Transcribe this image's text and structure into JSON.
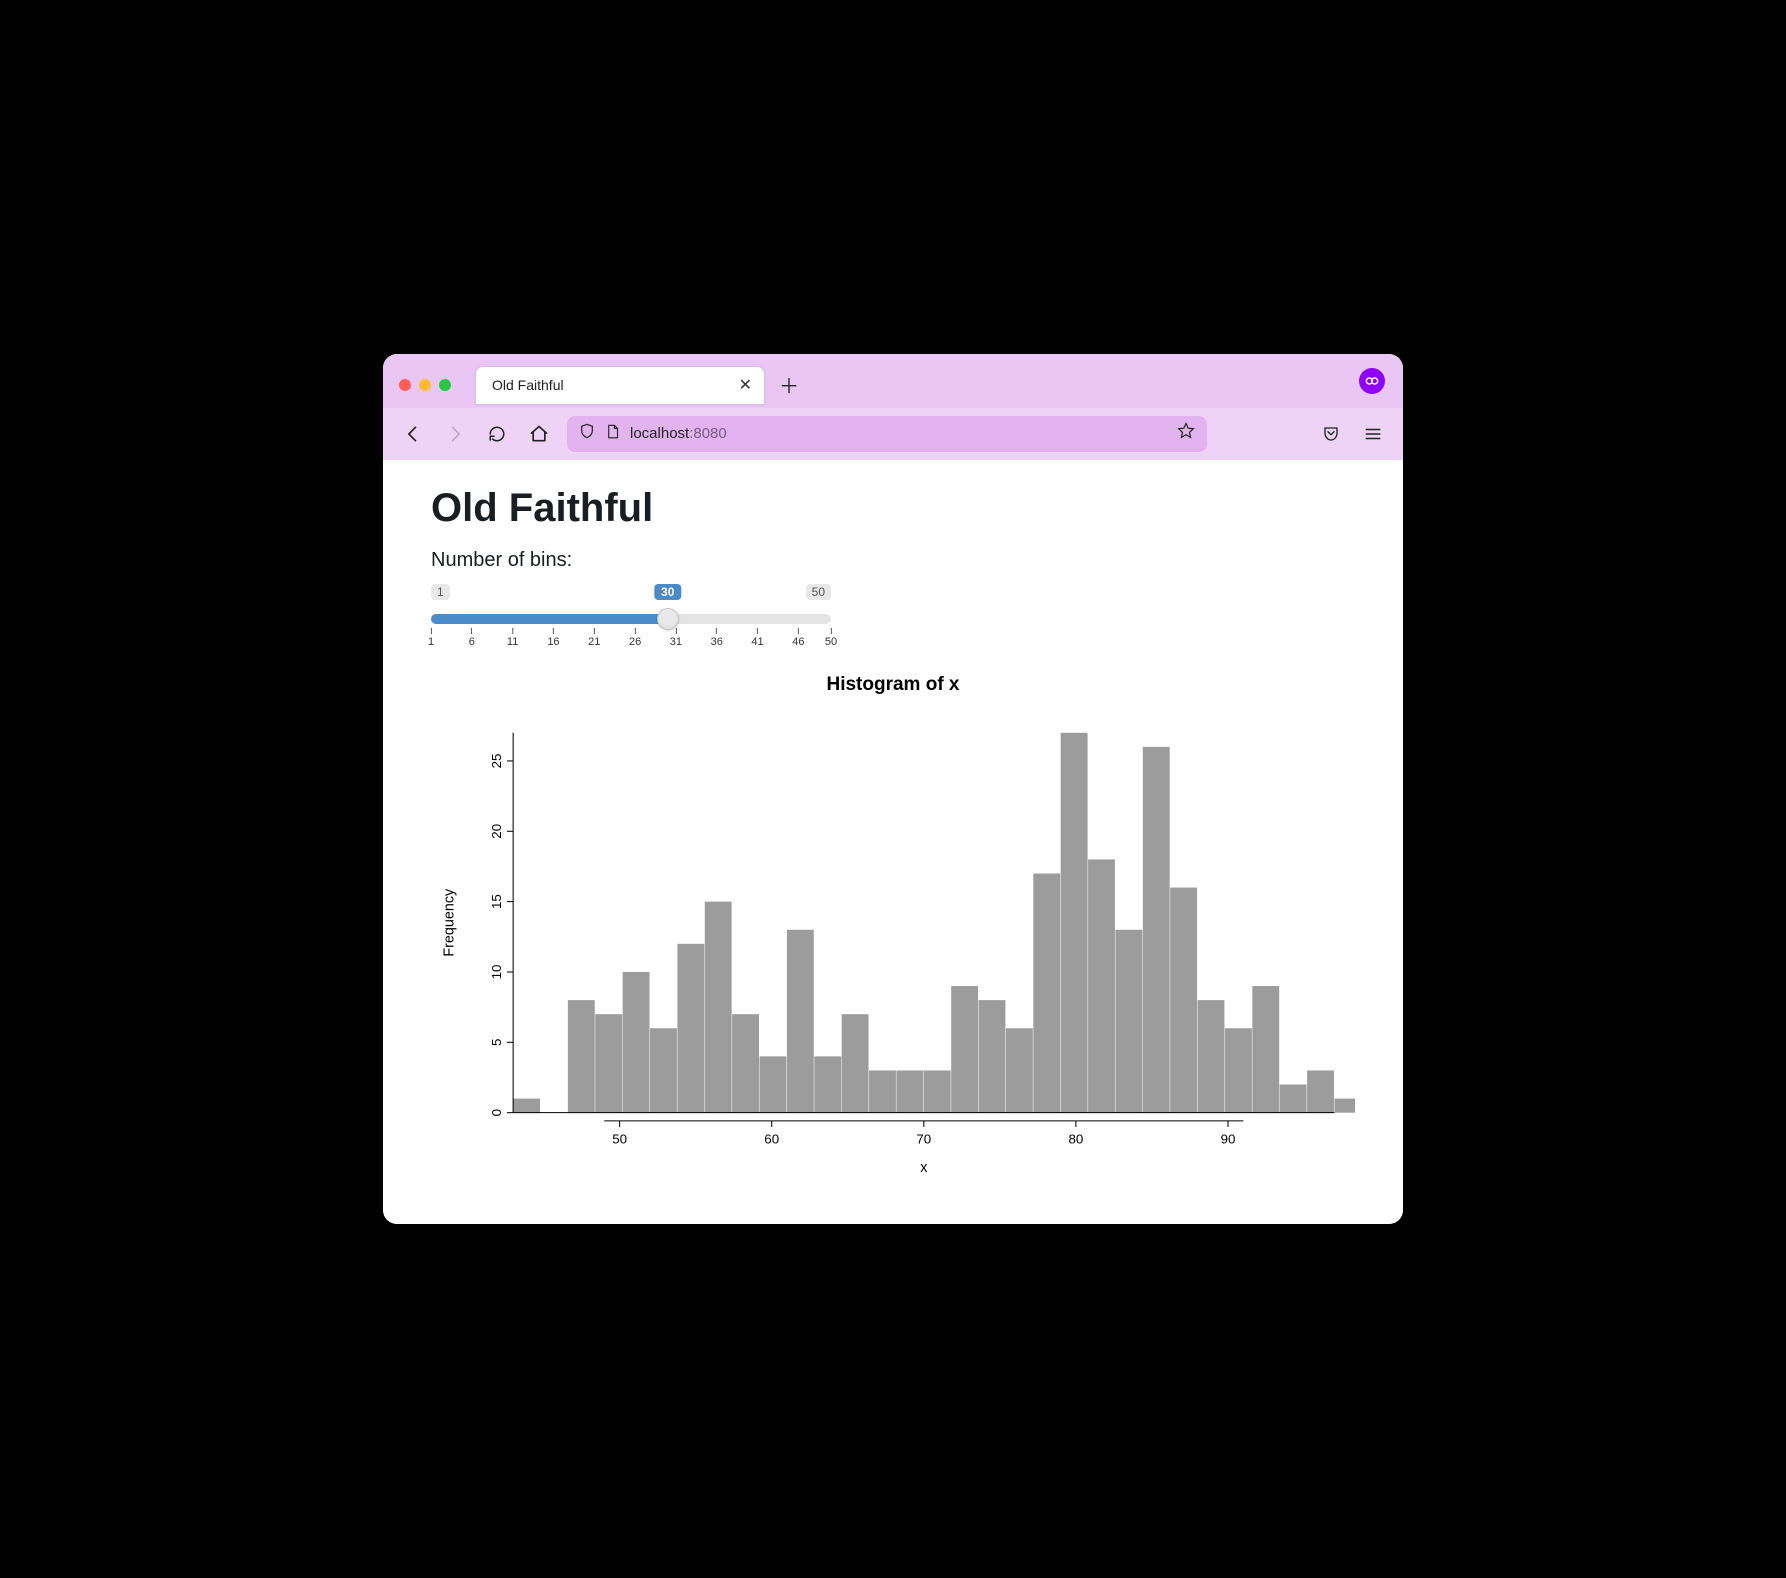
{
  "browser": {
    "tab_title": "Old Faithful",
    "url_host": "localhost",
    "url_port": ":8080"
  },
  "page": {
    "title": "Old Faithful",
    "slider": {
      "label": "Number of bins:",
      "min": 1,
      "max": 50,
      "value": 30,
      "major_ticks": [
        1,
        6,
        11,
        16,
        21,
        26,
        31,
        36,
        41,
        46,
        50
      ]
    }
  },
  "chart_data": {
    "type": "bar",
    "title": "Histogram of x",
    "xlabel": "x",
    "ylabel": "Frequency",
    "xlim": [
      43,
      97
    ],
    "ylim": [
      0,
      27
    ],
    "x_ticks": [
      50,
      60,
      70,
      80,
      90
    ],
    "y_ticks": [
      0,
      5,
      10,
      15,
      20,
      25
    ],
    "bin_width": 1.8,
    "bins_start": 43,
    "values": [
      1,
      0,
      8,
      7,
      10,
      6,
      12,
      15,
      7,
      4,
      13,
      4,
      7,
      3,
      3,
      3,
      9,
      8,
      6,
      17,
      27,
      18,
      13,
      26,
      16,
      8,
      6,
      9,
      2,
      3,
      1
    ]
  }
}
